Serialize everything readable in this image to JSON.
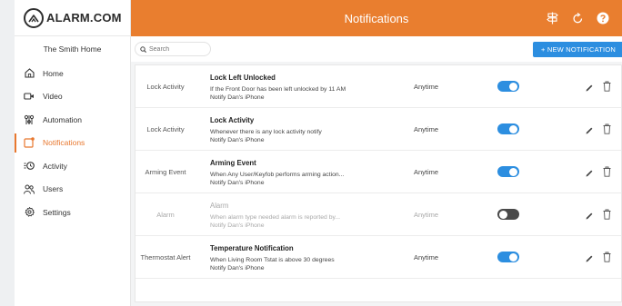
{
  "brand": {
    "logo_text": "ALARM.COM"
  },
  "sidebar": {
    "home_name": "The Smith Home",
    "items": [
      {
        "label": "Home",
        "icon": "home-icon"
      },
      {
        "label": "Video",
        "icon": "video-icon"
      },
      {
        "label": "Automation",
        "icon": "automation-icon"
      },
      {
        "label": "Notifications",
        "icon": "notification-icon",
        "active": true
      },
      {
        "label": "Activity",
        "icon": "activity-icon"
      },
      {
        "label": "Users",
        "icon": "users-icon"
      },
      {
        "label": "Settings",
        "icon": "settings-icon"
      }
    ]
  },
  "header": {
    "title": "Notifications",
    "icons": [
      "signpost-icon",
      "refresh-icon",
      "help-icon"
    ]
  },
  "toolbar": {
    "search_placeholder": "Search",
    "new_button_label": "+ NEW NOTIFICATION"
  },
  "notifications": [
    {
      "type": "Lock Activity",
      "title": "Lock Left Unlocked",
      "line1": "If the Front Door has been left unlocked by 11 AM",
      "line2": "Notify Dan's iPhone",
      "schedule": "Anytime",
      "enabled": true
    },
    {
      "type": "Lock Activity",
      "title": "Lock Activity",
      "line1": "Whenever there is any lock activity notify",
      "line2": "Notify Dan's iPhone",
      "schedule": "Anytime",
      "enabled": true
    },
    {
      "type": "Arming Event",
      "title": "Arming Event",
      "line1": "When Any User/Keyfob performs arming action...",
      "line2": "Notify Dan's iPhone",
      "schedule": "Anytime",
      "enabled": true
    },
    {
      "type": "Alarm",
      "title": "Alarm",
      "line1": "When alarm type needed alarm is reported by...",
      "line2": "Notify Dan's iPhone",
      "schedule": "Anytime",
      "enabled": false
    },
    {
      "type": "Thermostat Alert",
      "title": "Temperature Notification",
      "line1": "When Living Room Tstat is above 30 degrees",
      "line2": "Notify Dan's iPhone",
      "schedule": "Anytime",
      "enabled": true
    }
  ],
  "colors": {
    "accent": "#e97e2f",
    "primary_button": "#2c8ee0",
    "toggle_on": "#2c8ee0",
    "toggle_off": "#4a4a4a"
  }
}
